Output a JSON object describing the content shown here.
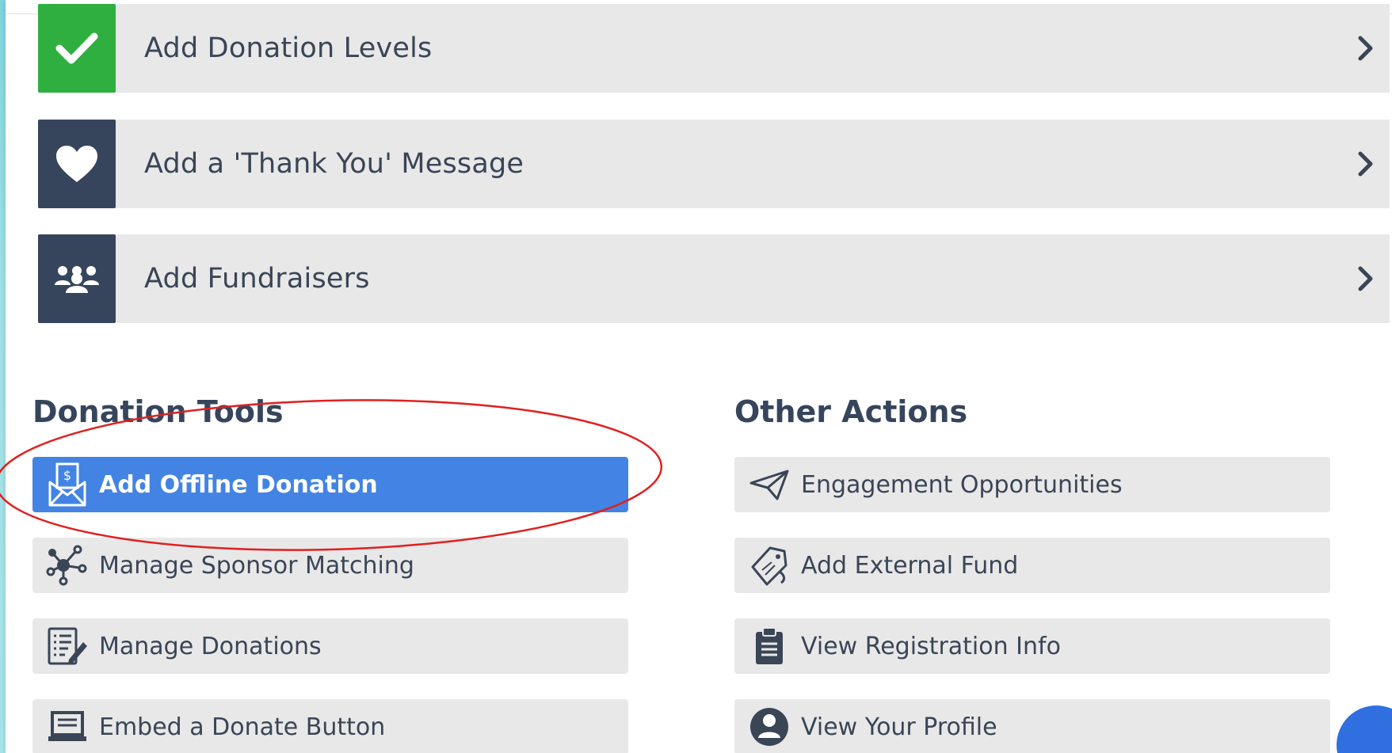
{
  "colors": {
    "step_bg": "#e8e8e8",
    "check_green": "#2faf3f",
    "icon_navy": "#36455c",
    "active_blue": "#4383e4",
    "annotation_red": "#e02020"
  },
  "steps": [
    {
      "label": "Add Donation Levels",
      "icon": "checkmark-icon"
    },
    {
      "label": "Add a 'Thank You' Message",
      "icon": "heart-icon"
    },
    {
      "label": "Add Fundraisers",
      "icon": "people-group-icon"
    }
  ],
  "donation_tools": {
    "title": "Donation Tools",
    "items": [
      {
        "label": "Add Offline Donation",
        "icon": "envelope-dollar-icon",
        "active": true
      },
      {
        "label": "Manage Sponsor Matching",
        "icon": "network-nodes-icon"
      },
      {
        "label": "Manage Donations",
        "icon": "list-edit-icon"
      },
      {
        "label": "Embed a Donate Button",
        "icon": "laptop-icon"
      }
    ]
  },
  "other_actions": {
    "title": "Other Actions",
    "items": [
      {
        "label": "Engagement Opportunities",
        "icon": "paper-plane-icon"
      },
      {
        "label": "Add External Fund",
        "icon": "tag-hand-icon"
      },
      {
        "label": "View Registration Info",
        "icon": "clipboard-icon"
      },
      {
        "label": "View Your Profile",
        "icon": "user-circle-icon"
      }
    ]
  }
}
